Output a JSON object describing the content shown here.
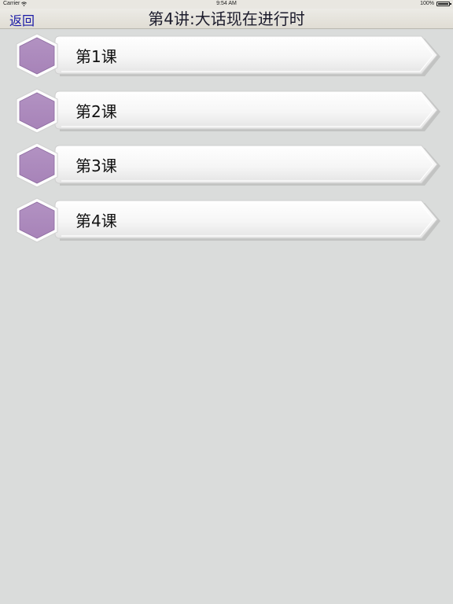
{
  "status_bar": {
    "carrier": "Carrier",
    "time": "9:54 AM",
    "battery": "100%",
    "battery_level": 1.0,
    "wifi_icon": "wifi-icon"
  },
  "nav": {
    "back_label": "返回",
    "title": "第4讲:大话现在进行时"
  },
  "colors": {
    "background": "#dadcdb",
    "hexagon": "#a783b8",
    "back_link": "#1a1aa6"
  },
  "lessons": [
    {
      "label": "第1课",
      "icon": "hexagon-icon"
    },
    {
      "label": "第2课",
      "icon": "hexagon-icon"
    },
    {
      "label": "第3课",
      "icon": "hexagon-icon"
    },
    {
      "label": "第4课",
      "icon": "hexagon-icon"
    }
  ]
}
